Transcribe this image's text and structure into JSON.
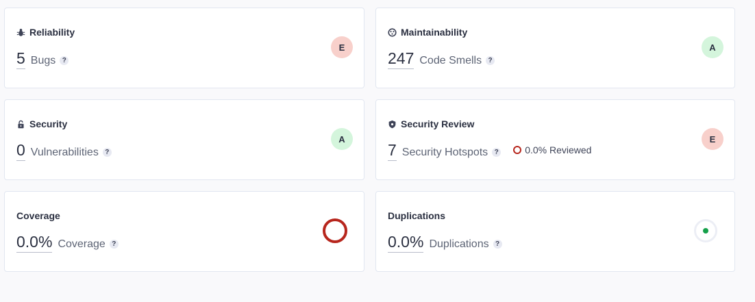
{
  "colors": {
    "rating_bad_bg": "#f8d0cb",
    "rating_good_bg": "#d4f5dc",
    "coverage_ring": "#b7261d",
    "duplications_dot": "#15a04a"
  },
  "cards": {
    "reliability": {
      "title": "Reliability",
      "icon": "bug-icon",
      "value": "5",
      "label": "Bugs",
      "help": "?",
      "rating": "E"
    },
    "maintainability": {
      "title": "Maintainability",
      "icon": "maintainability-icon",
      "value": "247",
      "label": "Code Smells",
      "help": "?",
      "rating": "A"
    },
    "security": {
      "title": "Security",
      "icon": "lock-icon",
      "value": "0",
      "label": "Vulnerabilities",
      "help": "?",
      "rating": "A"
    },
    "security_review": {
      "title": "Security Review",
      "icon": "shield-icon",
      "value": "7",
      "label": "Security Hotspots",
      "help": "?",
      "reviewed": "0.0% Reviewed",
      "rating": "E"
    },
    "coverage": {
      "title": "Coverage",
      "value": "0.0%",
      "label": "Coverage",
      "help": "?",
      "indicator": "coverage-ring-icon"
    },
    "duplications": {
      "title": "Duplications",
      "value": "0.0%",
      "label": "Duplications",
      "help": "?",
      "indicator": "duplications-dot-icon"
    }
  }
}
